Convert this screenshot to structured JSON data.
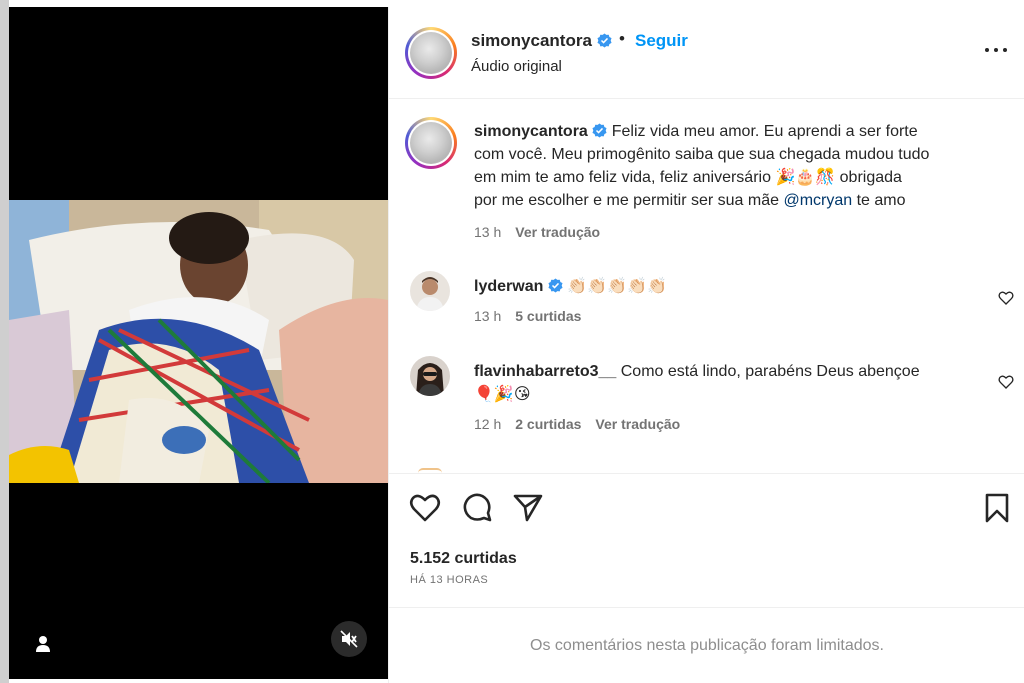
{
  "post": {
    "username": "simonycantora",
    "follow_label": "Seguir",
    "dot": "•",
    "audio": "Áudio original"
  },
  "caption": {
    "username": "simonycantora",
    "line1": "Feliz vida meu amor. Eu aprendi a ser forte",
    "line2": "com você. Meu primogênito saiba que sua chegada mudou tudo",
    "line3": "em mim te amo feliz vida, feliz aniversário",
    "line3_emoji": "🎉🎂🎊",
    "line3_end": "obrigada",
    "line4": "por me escolher e me permitir ser sua mãe",
    "mention": "@mcryan",
    "line4_end": "te amo",
    "time": "13 h",
    "translate": "Ver tradução"
  },
  "comments": [
    {
      "username": "lyderwan",
      "text": "👏🏻👏🏻👏🏻👏🏻👏🏻",
      "time": "13 h",
      "likes": "5 curtidas"
    },
    {
      "username": "flavinhabarreto3__",
      "text": "Como está lindo, parabéns Deus abençoe",
      "text2": "🎈🎉😘",
      "time": "12 h",
      "likes": "2 curtidas",
      "translate": "Ver tradução"
    }
  ],
  "stats": {
    "likes": "5.152 curtidas",
    "time": "HÁ 13 HORAS"
  },
  "footer": {
    "limited": "Os comentários nesta publicação foram limitados."
  },
  "colors": {
    "accent": "#0095f6",
    "verified": "#3897f0",
    "muted": "#737373",
    "text": "#262626"
  },
  "icons": [
    "verified-badge-icon",
    "more-options-icon",
    "heart-icon",
    "comment-icon",
    "share-icon",
    "bookmark-icon",
    "user-tag-icon",
    "mute-icon"
  ]
}
